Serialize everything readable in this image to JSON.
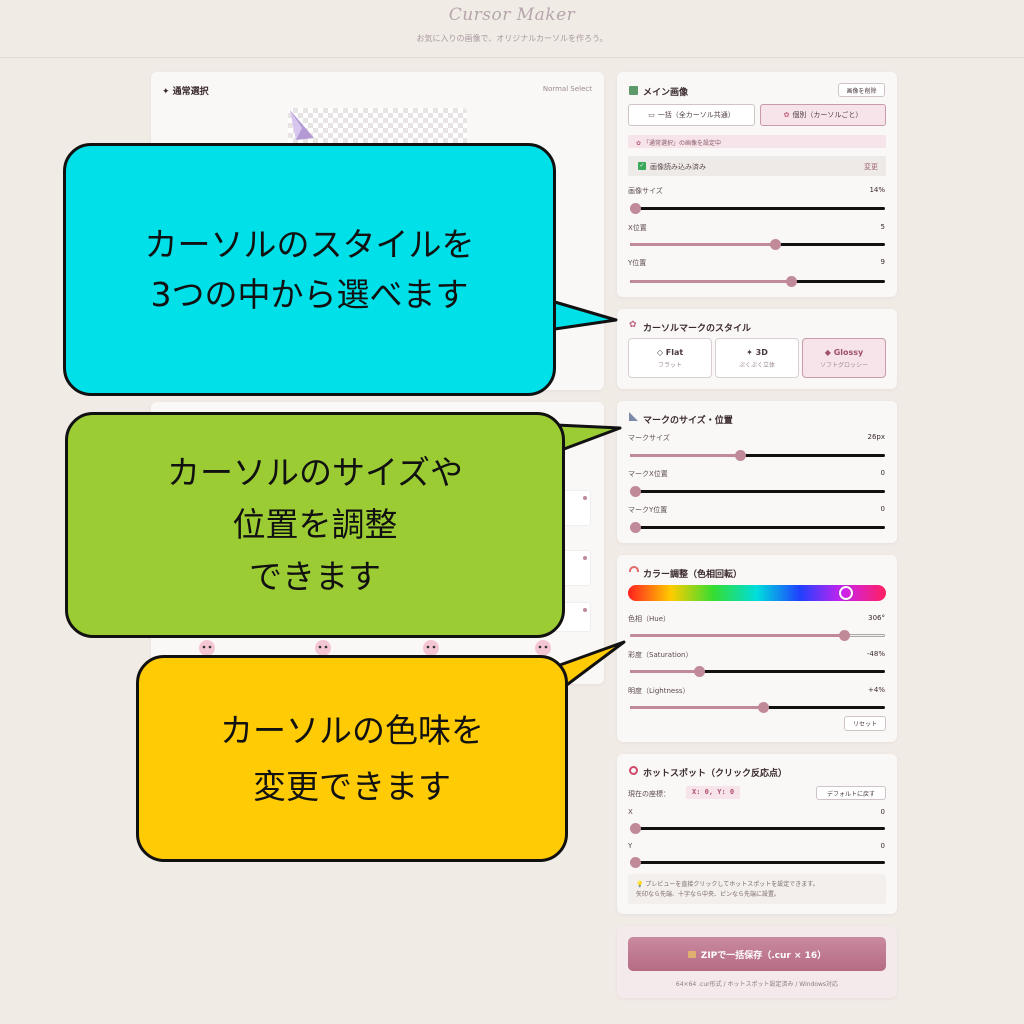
{
  "header": {
    "title": "Cursor Maker",
    "subtitle": "お気に入りの画像で、オリジナルカーソルを作ろう。"
  },
  "left_panel": {
    "title": "✦ 通常選択",
    "subtitle": "Normal Select"
  },
  "main_image": {
    "title": "メイン画像",
    "delete_label": "画像を削除",
    "mode_all_label": "一括（全カーソル共通）",
    "mode_each_label": "個別（カーソルごと）",
    "notice": "「通常選択」の画像を設定中",
    "loaded_label": "画像読み込み済み",
    "change_label": "変更",
    "size_label": "画像サイズ",
    "size_value": "14%",
    "size_level": 0.02,
    "x_label": "X位置",
    "x_value": "5",
    "x_level": 0.57,
    "y_label": "Y位置",
    "y_value": "9",
    "y_level": 0.63
  },
  "mark_style": {
    "title": "カーソルマークのスタイル",
    "options": [
      {
        "label": "◇ Flat",
        "sub": "フラット"
      },
      {
        "label": "✦ 3D",
        "sub": "ぷくぷく立体"
      },
      {
        "label": "◆ Glossy",
        "sub": "ソフトグロッシー"
      }
    ],
    "selected": "Glossy"
  },
  "mark_size": {
    "title": "マークのサイズ・位置",
    "size_label": "マークサイズ",
    "size_value": "26px",
    "size_level": 0.43,
    "x_label": "マークX位置",
    "x_value": "0",
    "x_level": 0.02,
    "y_label": "マークY位置",
    "y_value": "0",
    "y_level": 0.02
  },
  "color": {
    "title": "カラー調整（色相回転）",
    "hue_label": "色相（Hue）",
    "hue_value": "306°",
    "hue_level": 0.84,
    "sat_label": "彩度（Saturation）",
    "sat_value": "-48%",
    "sat_level": 0.27,
    "light_label": "明度（Lightness）",
    "light_value": "+4%",
    "light_level": 0.52,
    "reset_label": "リセット"
  },
  "hotspot": {
    "title": "ホットスポット（クリック反応点）",
    "coord_label": "現在の座標：",
    "coord_value": "X: 0, Y: 0",
    "default_label": "デフォルトに戻す",
    "x_label": "X",
    "x_value": "0",
    "x_level": 0.02,
    "y_label": "Y",
    "y_value": "0",
    "y_level": 0.02,
    "tip_line1": "💡 プレビューを直接クリックしてホットスポットを設定できます。",
    "tip_line2": "矢印なら先端、十字なら中央、ピンなら先端に設置。"
  },
  "save": {
    "label": "ZIPで一括保存（.cur × 16）",
    "note": "64×64 .cur形式 / ホットスポット設定済み / Windows対応"
  },
  "callouts": {
    "style_line1": "カーソルのスタイルを",
    "style_line2": "3つの中から選べます",
    "size_line1": "カーソルのサイズや",
    "size_line2": "位置を調整",
    "size_line3": "できます",
    "color_line1": "カーソルの色味を",
    "color_line2": "変更できます"
  },
  "colors": {
    "accent": "#c08a98",
    "save_button": "#b86f86",
    "callout_cyan": "#00e0e8",
    "callout_green": "#9ccc33",
    "callout_yellow": "#ffcb05"
  }
}
